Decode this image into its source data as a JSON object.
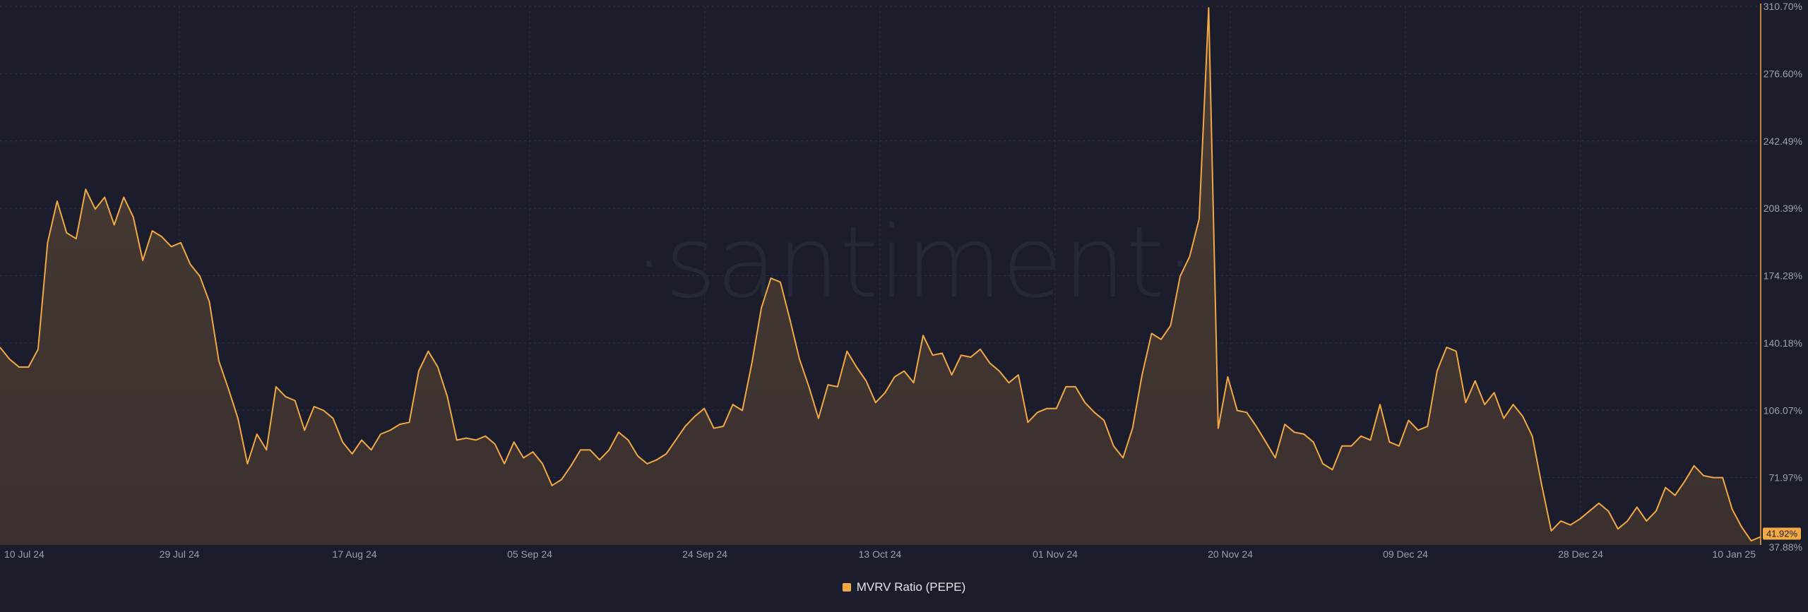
{
  "watermark": "·santiment·",
  "legend": {
    "label": "MVRV Ratio (PEPE)"
  },
  "colors": {
    "background": "#1b1d2c",
    "line": "#f2a845",
    "grid": "#2d3044",
    "axis_text": "#9aa0b4",
    "area_top": "#4a3c35"
  },
  "chart_data": {
    "type": "area",
    "title": "",
    "xlabel": "",
    "ylabel": "",
    "grid": true,
    "y_axis_position": "right",
    "ylim": [
      37.88,
      310.7
    ],
    "y_ticks": [
      "37.88%",
      "71.97%",
      "106.07%",
      "140.18%",
      "174.28%",
      "208.39%",
      "242.49%",
      "276.60%",
      "310.70%"
    ],
    "x_ticks": [
      "10 Jul 24",
      "29 Jul 24",
      "17 Aug 24",
      "05 Sep 24",
      "24 Sep 24",
      "13 Oct 24",
      "01 Nov 24",
      "20 Nov 24",
      "09 Dec 24",
      "28 Dec 24",
      "10 Jan 25"
    ],
    "current_value_label": "41.92%",
    "series": [
      {
        "name": "MVRV Ratio (PEPE)",
        "values": [
          138,
          132,
          128,
          128,
          137,
          191,
          212,
          196,
          193,
          218,
          208,
          214,
          200,
          214,
          204,
          182,
          197,
          194,
          189,
          191,
          180,
          174,
          161,
          131,
          117,
          102,
          79,
          94,
          86,
          118,
          113,
          111,
          96,
          108,
          106,
          102,
          90,
          84,
          91,
          86,
          94,
          96,
          99,
          100,
          126,
          136,
          128,
          113,
          91,
          92,
          91,
          93,
          89,
          79,
          90,
          82,
          85,
          79,
          68,
          71,
          78,
          86,
          86,
          81,
          86,
          95,
          91,
          83,
          79,
          81,
          84,
          91,
          98,
          103,
          107,
          97,
          98,
          109,
          106,
          130,
          158,
          173,
          171,
          152,
          132,
          118,
          102,
          119,
          118,
          136,
          128,
          121,
          110,
          115,
          123,
          126,
          120,
          144,
          134,
          135,
          124,
          134,
          133,
          137,
          130,
          126,
          120,
          124,
          100,
          105,
          107,
          107,
          118,
          118,
          110,
          105,
          101,
          88,
          82,
          97,
          124,
          145,
          142,
          149,
          174,
          184,
          203,
          310,
          97,
          123,
          106,
          105,
          98,
          90,
          82,
          99,
          95,
          94,
          90,
          79,
          76,
          88,
          88,
          93,
          91,
          109,
          90,
          88,
          101,
          96,
          98,
          126,
          138,
          136,
          110,
          121,
          109,
          115,
          102,
          109,
          103,
          93,
          68,
          45,
          50,
          48,
          51,
          55,
          59,
          55,
          46,
          50,
          57,
          50,
          55,
          67,
          63,
          70,
          78,
          73,
          72,
          72,
          56,
          47,
          40,
          42
        ]
      }
    ]
  }
}
